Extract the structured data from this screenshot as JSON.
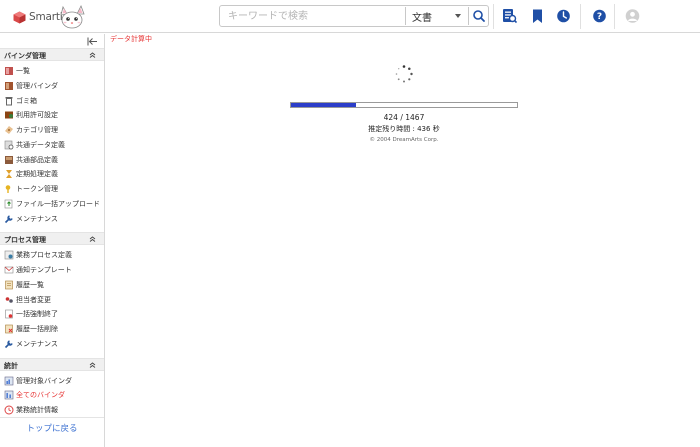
{
  "header": {
    "logo_text": "SmartDB",
    "search_placeholder": "キーワードで検索",
    "search_scope": "文書"
  },
  "sidebar": {
    "sections": [
      {
        "title": "バインダ管理",
        "items": [
          {
            "label": "一覧",
            "icon": "binder-list-icon"
          },
          {
            "label": "管理バインダ",
            "icon": "managed-binder-icon"
          },
          {
            "label": "ゴミ箱",
            "icon": "trash-icon"
          },
          {
            "label": "利用許可設定",
            "icon": "permission-icon"
          },
          {
            "label": "カテゴリ管理",
            "icon": "category-icon"
          },
          {
            "label": "共通データ定義",
            "icon": "common-data-icon"
          },
          {
            "label": "共通部品定義",
            "icon": "common-parts-icon"
          },
          {
            "label": "定期処理定義",
            "icon": "hourglass-icon"
          },
          {
            "label": "トークン管理",
            "icon": "key-icon"
          },
          {
            "label": "ファイル一括アップロード",
            "icon": "upload-icon"
          },
          {
            "label": "メンテナンス",
            "icon": "wrench-icon"
          }
        ]
      },
      {
        "title": "プロセス管理",
        "items": [
          {
            "label": "業務プロセス定義",
            "icon": "process-def-icon"
          },
          {
            "label": "通知テンプレート",
            "icon": "mail-template-icon"
          },
          {
            "label": "履歴一覧",
            "icon": "history-icon"
          },
          {
            "label": "担当者変更",
            "icon": "assignee-change-icon"
          },
          {
            "label": "一括強制終了",
            "icon": "force-end-icon"
          },
          {
            "label": "履歴一括削除",
            "icon": "history-delete-icon"
          },
          {
            "label": "メンテナンス",
            "icon": "wrench-icon"
          }
        ]
      },
      {
        "title": "統計",
        "items": [
          {
            "label": "管理対象バインダ",
            "icon": "stats-binder-icon"
          },
          {
            "label": "全てのバインダ",
            "icon": "all-binders-icon",
            "active": true
          },
          {
            "label": "業務統計情報",
            "icon": "clock-stats-icon"
          }
        ]
      }
    ],
    "back_to_top": "トップに戻る"
  },
  "main": {
    "status_label": "データ計算中",
    "progress": {
      "current": 424,
      "total": 1467,
      "fraction": 0.289
    },
    "count_text": "424 / 1467",
    "remaining_text": "推定残り時間 : 436 秒",
    "copyright": "© 2004 DreamArts Corp."
  },
  "colors": {
    "accent_blue": "#1f4fa6",
    "progress_fill": "#2c3ec9",
    "active_red": "#e63333",
    "logo_red": "#d94848"
  }
}
